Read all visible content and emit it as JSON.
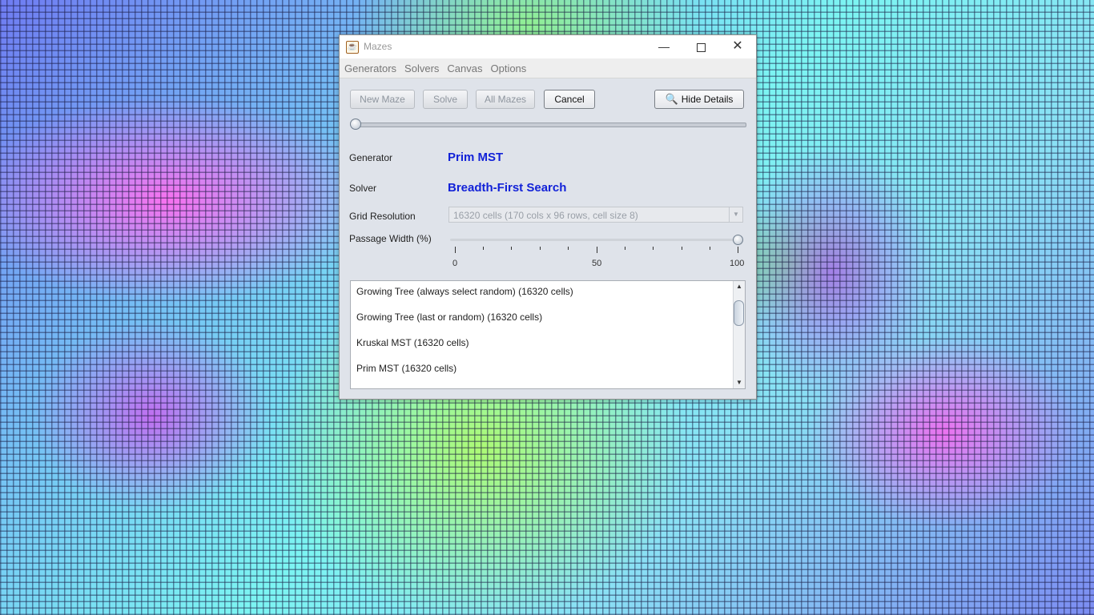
{
  "window": {
    "title": "Mazes"
  },
  "menu": [
    "Generators",
    "Solvers",
    "Canvas",
    "Options"
  ],
  "toolbar": {
    "new_maze": "New Maze",
    "solve": "Solve",
    "all_mazes": "All Mazes",
    "cancel": "Cancel",
    "hide_details": "Hide Details"
  },
  "progress": {
    "value": 0
  },
  "details": {
    "generator_label": "Generator",
    "generator_value": "Prim MST",
    "solver_label": "Solver",
    "solver_value": "Breadth-First Search",
    "grid_label": "Grid Resolution",
    "grid_value": "16320 cells (170 cols x 96 rows, cell size 8)",
    "passage_label": "Passage Width (%)",
    "passage_value": 100,
    "ticks": [
      "0",
      "50",
      "100"
    ]
  },
  "list": {
    "items": [
      "Growing Tree (always select random) (16320 cells)",
      "Growing Tree (last or random) (16320 cells)",
      "Kruskal MST (16320 cells)",
      "Prim MST (16320 cells)"
    ]
  },
  "colors": {
    "accent": "#1222d8"
  }
}
